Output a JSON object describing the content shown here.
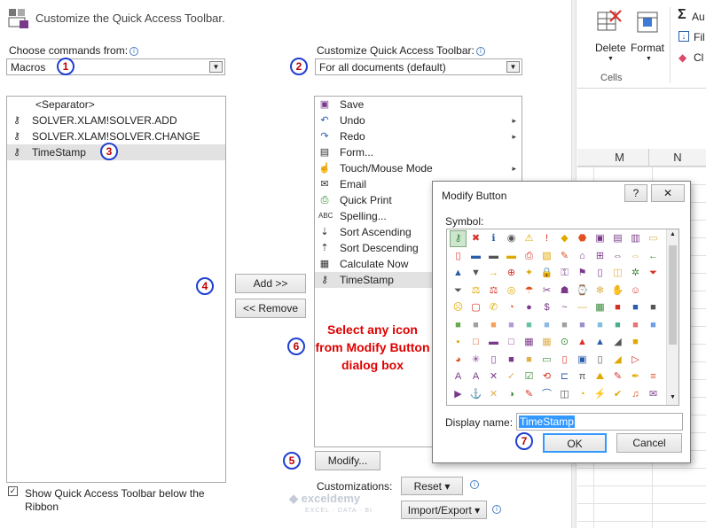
{
  "header": {
    "title": "Customize the Quick Access Toolbar."
  },
  "left": {
    "choose_label": "Choose commands from:",
    "choose_value": "Macros",
    "items": [
      {
        "label": "<Separator>",
        "icon": "separator"
      },
      {
        "label": "SOLVER.XLAM!SOLVER.ADD",
        "icon": "macro-icon"
      },
      {
        "label": "SOLVER.XLAM!SOLVER.CHANGE",
        "icon": "macro-icon"
      },
      {
        "label": "TimeStamp",
        "icon": "macro-icon"
      }
    ],
    "checkbox_label_1": "Show Quick Access Toolbar below the",
    "checkbox_label_2": "Ribbon"
  },
  "right": {
    "customize_label": "Customize Quick Access Toolbar:",
    "customize_value": "For all documents (default)",
    "items": [
      {
        "label": "Save",
        "icon": "save-icon",
        "sub": ""
      },
      {
        "label": "Undo",
        "icon": "undo-icon",
        "sub": "▸"
      },
      {
        "label": "Redo",
        "icon": "redo-icon",
        "sub": "▸"
      },
      {
        "label": "Form...",
        "icon": "form-icon",
        "sub": ""
      },
      {
        "label": "Touch/Mouse Mode",
        "icon": "touch-icon",
        "sub": "▸"
      },
      {
        "label": "Email",
        "icon": "email-icon",
        "sub": ""
      },
      {
        "label": "Quick Print",
        "icon": "print-icon",
        "sub": ""
      },
      {
        "label": "Spelling...",
        "icon": "spelling-icon",
        "sub": ""
      },
      {
        "label": "Sort Ascending",
        "icon": "sort-asc-icon",
        "sub": ""
      },
      {
        "label": "Sort Descending",
        "icon": "sort-desc-icon",
        "sub": ""
      },
      {
        "label": "Calculate Now",
        "icon": "calculator-icon",
        "sub": ""
      },
      {
        "label": "TimeStamp",
        "icon": "macro-icon",
        "sub": ""
      }
    ],
    "modify_label": "Modify...",
    "customizations_label": "Customizations:",
    "reset_label": "Reset ▾",
    "import_export_label": "Import/Export ▾"
  },
  "buttons": {
    "add": "Add >>",
    "remove": "<< Remove"
  },
  "annotation": {
    "line1": "Select any icon",
    "line2": "from Modify Button",
    "line3": "dialog box",
    "color": "#e00000"
  },
  "badges": [
    "1",
    "2",
    "3",
    "4",
    "5",
    "6",
    "7"
  ],
  "dialog": {
    "title": "Modify Button",
    "help": "?",
    "close": "✕",
    "symbol_label": "Symbol:",
    "display_name_label": "Display name:",
    "display_name_value": "TimeStamp",
    "ok": "OK",
    "cancel": "Cancel"
  },
  "excel": {
    "delete_label": "Delete",
    "format_label": "Format",
    "cells_group": "Cells",
    "autosum_label": "Au",
    "fill_label": "Fil",
    "clear_label": "Cl",
    "col_m": "M",
    "col_n": "N"
  },
  "watermark": {
    "name": "exceldemy",
    "tag": "EXCEL · DATA · BI"
  }
}
